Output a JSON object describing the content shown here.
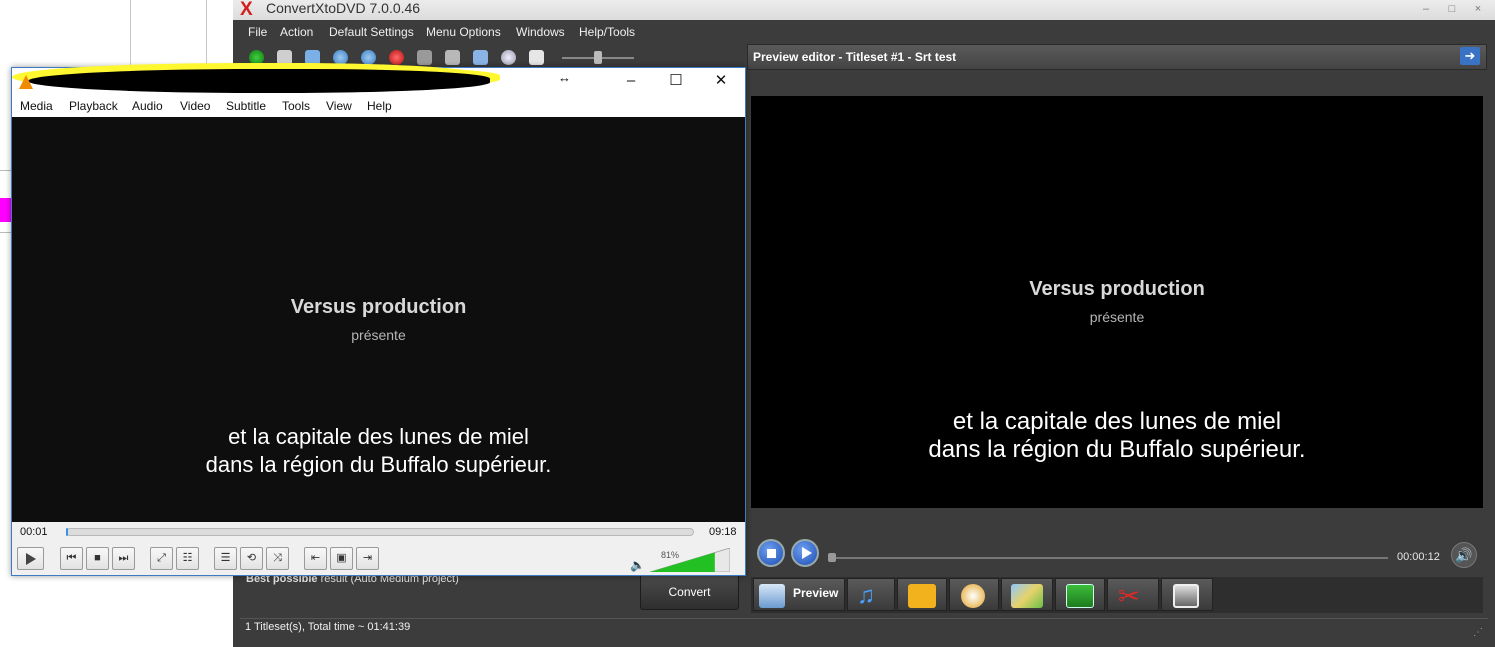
{
  "converter": {
    "title": "ConvertXtoDVD 7.0.0.46",
    "logo_glyph": "X",
    "menu": [
      "File",
      "Action",
      "Default Settings",
      "Menu Options",
      "Windows",
      "Help/Tools"
    ],
    "preview_header": "Preview editor - Titleset #1 - Srt test",
    "preview_credit": "Versus production",
    "preview_credit_sub": "présente",
    "preview_sub_line1": "et la capitale des lunes de miel",
    "preview_sub_line2": "dans la région du Buffalo supérieur.",
    "preview_time": "00:00:12",
    "tabs": {
      "preview_label": "Preview"
    },
    "result_bold": "Best possible",
    "result_rest": " result (Auto Medium project)",
    "convert_label": "Convert",
    "status": "1 Titleset(s), Total time ~ 01:41:39",
    "colors": {
      "accent_blue": "#3a72c4",
      "window_bg": "#3c3c3c"
    }
  },
  "vlc": {
    "menu": [
      "Media",
      "Playback",
      "Audio",
      "Video",
      "Subtitle",
      "Tools",
      "View",
      "Help"
    ],
    "credit": "Versus production",
    "credit_sub": "présente",
    "sub_line1": "et la capitale des lunes de miel",
    "sub_line2": "dans la région du Buffalo supérieur.",
    "time_current": "00:01",
    "time_total": "09:18",
    "volume_pct": "81%",
    "volume_level": 0.81,
    "seek_position": 0.002,
    "colors": {
      "border": "#3c7bc4",
      "volume_green": "#22c022",
      "cone_orange": "#f08a00"
    }
  }
}
